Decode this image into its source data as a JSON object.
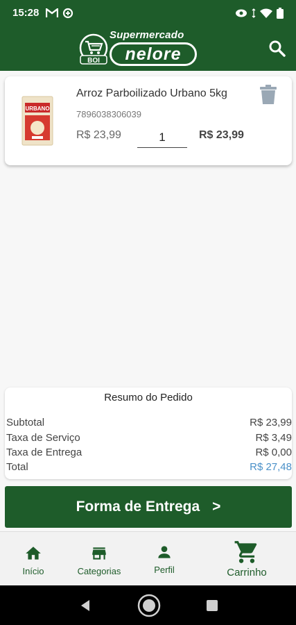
{
  "status_bar": {
    "time": "15:28"
  },
  "header": {
    "logo_top": "Supermercado",
    "logo_brand": "nelore",
    "logo_badge": "BOI"
  },
  "cart": {
    "items": [
      {
        "name": "Arroz Parboilizado Urbano 5kg",
        "code": "7896038306039",
        "unit_price": "R$ 23,99",
        "quantity": "1",
        "line_total": "R$ 23,99",
        "image_label": "URBANO"
      }
    ]
  },
  "summary": {
    "title": "Resumo do Pedido",
    "rows": [
      {
        "label": "Subtotal",
        "value": "R$ 23,99"
      },
      {
        "label": "Taxa de Serviço",
        "value": "R$ 3,49"
      },
      {
        "label": "Taxa de Entrega",
        "value": "R$ 0,00"
      },
      {
        "label": "Total",
        "value": "R$ 27,48"
      }
    ]
  },
  "delivery_button": {
    "label": "Forma de Entrega",
    "arrow": ">"
  },
  "bottom_nav": {
    "items": [
      {
        "label": "Início",
        "icon": "home-icon"
      },
      {
        "label": "Categorias",
        "icon": "store-icon"
      },
      {
        "label": "Perfil",
        "icon": "person-icon"
      },
      {
        "label": "Carrinho",
        "icon": "cart-icon"
      }
    ],
    "active_index": 3
  },
  "colors": {
    "primary": "#1e5c2a",
    "total": "#4a90c8"
  }
}
